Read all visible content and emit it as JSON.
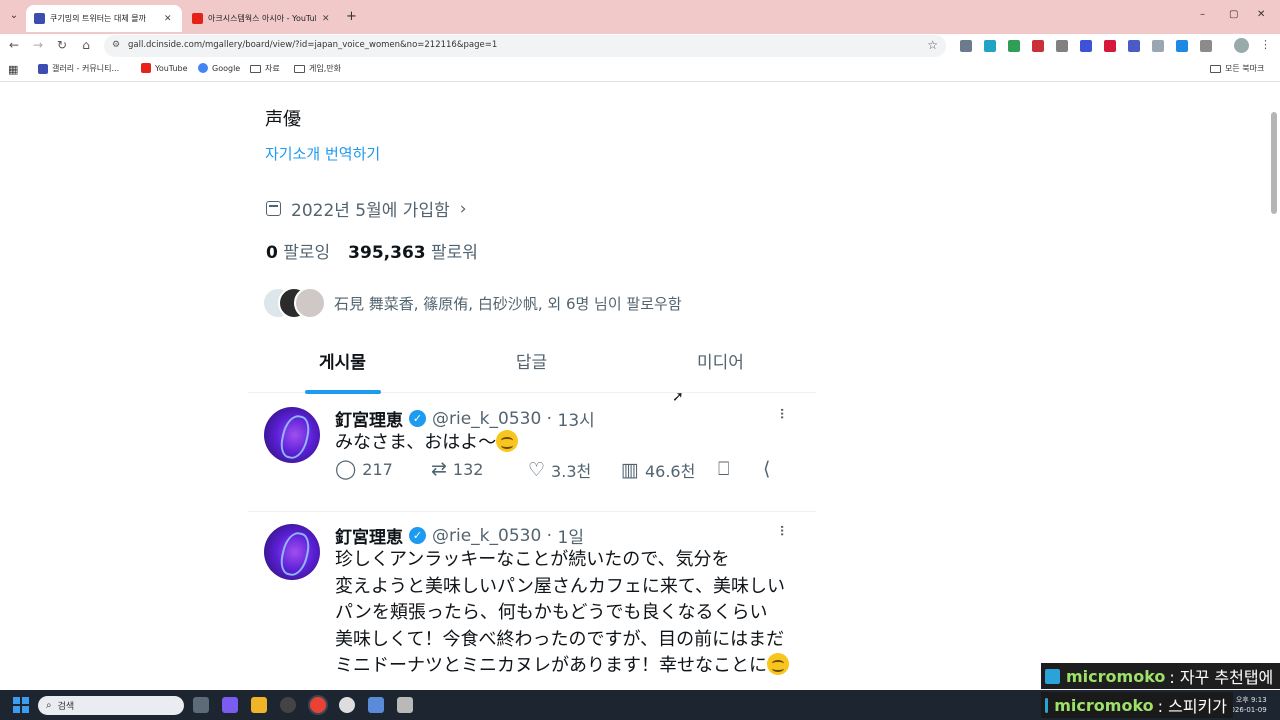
{
  "browser": {
    "tabs": [
      {
        "title": "쿠기밍의 트위터는 대체 몰까",
        "active": true
      },
      {
        "title": "아크시스템웍스 아시아 - YouTube",
        "active": false
      }
    ],
    "new_tab": "+",
    "window_controls": [
      "–",
      "▢",
      "✕"
    ],
    "url": "gall.dcinside.com/mgallery/board/view/?id=japan_voice_women&no=212116&page=1",
    "bookmarks": [
      {
        "label": "갤러리 - 커뮤니티...",
        "icon": "dcinside-icon"
      },
      {
        "label": "YouTube",
        "icon": "youtube-icon"
      },
      {
        "label": "Google",
        "icon": "google-icon"
      },
      {
        "label": "자료",
        "icon": "folder-icon"
      },
      {
        "label": "게임,만화",
        "icon": "folder-icon"
      }
    ],
    "all_bookmarks": "모든 북마크"
  },
  "profile": {
    "bio": "声優",
    "translate_bio": "자기소개 번역하기",
    "joined": "2022년 5월에 가입함",
    "following_count": "0",
    "following_label": "팔로잉",
    "followers_count": "395,363",
    "followers_label": "팔로워",
    "followed_by": "石見 舞菜香, 篠原侑, 白砂沙帆, 외 6명 님이 팔로우함"
  },
  "profile_tabs": [
    {
      "label": "게시물",
      "active": true
    },
    {
      "label": "답글",
      "active": false
    },
    {
      "label": "미디어",
      "active": false
    }
  ],
  "tweets": [
    {
      "name": "釘宮理恵",
      "handle": "@rie_k_0530",
      "time": "13시",
      "text": "みなさま、おはよ〜",
      "emoji": "smiling-face",
      "replies": "217",
      "retweets": "132",
      "likes": "3.3천",
      "views": "46.6천"
    },
    {
      "name": "釘宮理恵",
      "handle": "@rie_k_0530",
      "time": "1일",
      "text": "珍しくアンラッキーなことが続いたので、気分を\n変えようと美味しいパン屋さんカフェに来て、美味しい\nパンを頬張ったら、何もかもどうでも良くなるくらい\n美味しくて！今食べ終わったのですが、目の前にはまだ\nミニドーナツとミニカヌレがあります！幸せなことに",
      "emoji": "smiling-face"
    }
  ],
  "chat": [
    {
      "user": "micromoko",
      "message": ": 자꾸 추천탭에"
    },
    {
      "user": "micromoko",
      "message": ": 스피키가"
    }
  ],
  "taskbar": {
    "search_placeholder": "검색",
    "clock_time": "오후 9:13",
    "clock_date": "2026-01-09"
  },
  "colors": {
    "accent": "#1d9bf0",
    "tabstrip": "#f2c9c9",
    "secondary_text": "#536471",
    "chat_user": "#9fe06a"
  }
}
